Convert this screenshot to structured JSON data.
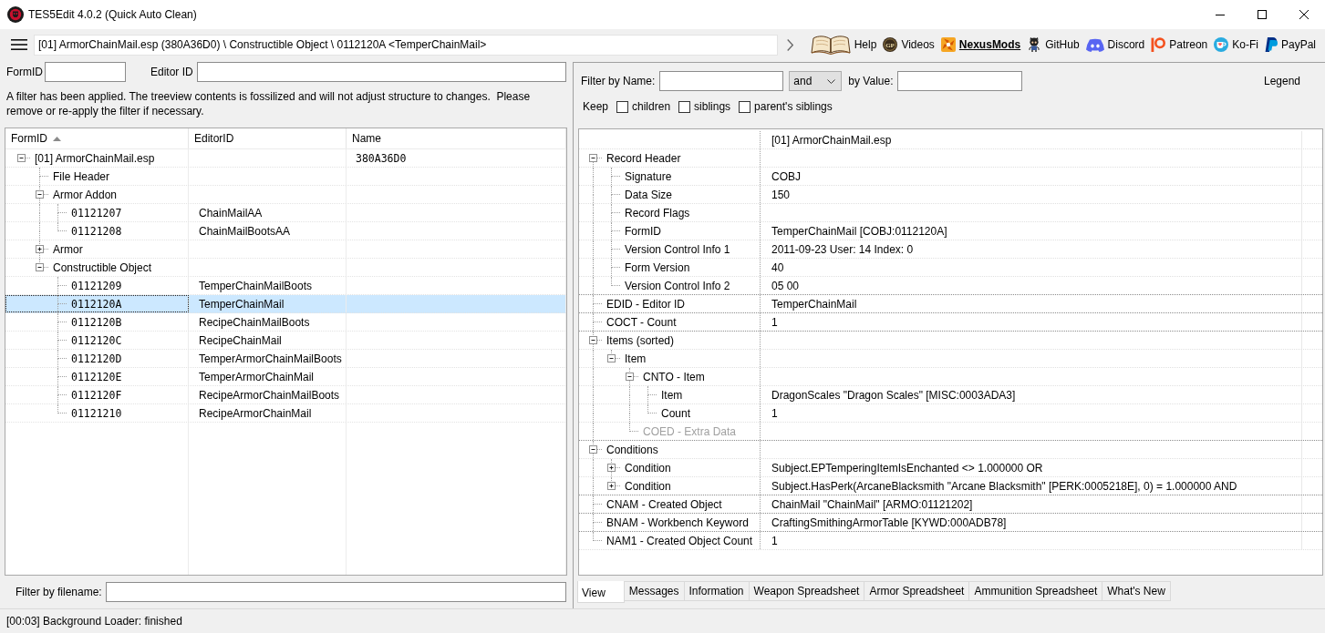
{
  "window": {
    "title": "TES5Edit 4.0.2 (Quick Auto Clean)"
  },
  "toolbar": {
    "path": "[01] ArmorChainMail.esp (380A36D0) \\ Constructible Object \\ 0112120A <TemperChainMail>",
    "links": [
      {
        "label": "Help",
        "kind": "book",
        "highlighted": false
      },
      {
        "label": "Videos",
        "kind": "coin",
        "badge": "GP",
        "highlighted": false
      },
      {
        "label": "NexusMods",
        "kind": "pinwheel",
        "highlighted": true
      },
      {
        "label": "GitHub",
        "kind": "mascot",
        "highlighted": false
      },
      {
        "label": "Discord",
        "kind": "controller",
        "highlighted": false
      },
      {
        "label": "Patreon",
        "kind": "pmark",
        "highlighted": false
      },
      {
        "label": "Ko-Fi",
        "kind": "cup",
        "highlighted": false
      },
      {
        "label": "PayPal",
        "kind": "plogo",
        "highlighted": false
      }
    ]
  },
  "left_panel": {
    "form_id_filter": {
      "label": "FormID"
    },
    "editor_id_filter": {
      "label": "Editor ID"
    },
    "notice": "A filter has been applied. The treeview contents is fossilized and will not adjust structure to changes.  Please remove or re-apply the filter if necessary.",
    "tree": {
      "columns": [
        {
          "label": "FormID",
          "sorted": true
        },
        {
          "label": "EditorID",
          "sorted": false
        },
        {
          "label": "Name",
          "sorted": false
        }
      ],
      "nodes": [
        {
          "kind": "group",
          "label": "[01] ArmorChainMail.esp",
          "name": "380A36D0",
          "expanded": true,
          "selected": false,
          "children": [
            {
              "kind": "group",
              "label": "File Header",
              "selected": false
            },
            {
              "kind": "group",
              "label": "Armor Addon",
              "expanded": true,
              "selected": false,
              "children": [
                {
                  "kind": "record",
                  "label": "01121207",
                  "editor_id": "ChainMailAA",
                  "selected": false
                },
                {
                  "kind": "record",
                  "label": "01121208",
                  "editor_id": "ChainMailBootsAA",
                  "selected": false
                }
              ]
            },
            {
              "kind": "group",
              "label": "Armor",
              "expanded": false,
              "selected": false
            },
            {
              "kind": "group",
              "label": "Constructible Object",
              "expanded": true,
              "selected": false,
              "children": [
                {
                  "kind": "record",
                  "label": "01121209",
                  "editor_id": "TemperChainMailBoots",
                  "selected": false
                },
                {
                  "kind": "record",
                  "label": "0112120A",
                  "editor_id": "TemperChainMail",
                  "selected": true
                },
                {
                  "kind": "record",
                  "label": "0112120B",
                  "editor_id": "RecipeChainMailBoots",
                  "selected": false
                },
                {
                  "kind": "record",
                  "label": "0112120C",
                  "editor_id": "RecipeChainMail",
                  "selected": false
                },
                {
                  "kind": "record",
                  "label": "0112120D",
                  "editor_id": "TemperArmorChainMailBoots",
                  "selected": false
                },
                {
                  "kind": "record",
                  "label": "0112120E",
                  "editor_id": "TemperArmorChainMail",
                  "selected": false
                },
                {
                  "kind": "record",
                  "label": "0112120F",
                  "editor_id": "RecipeArmorChainMailBoots",
                  "selected": false
                },
                {
                  "kind": "record",
                  "label": "01121210",
                  "editor_id": "RecipeArmorChainMail",
                  "selected": false
                }
              ]
            }
          ]
        }
      ]
    },
    "filename_filter": {
      "label": "Filter by filename:"
    }
  },
  "right_panel": {
    "name_filter": {
      "label": "Filter by Name:"
    },
    "operator": "and",
    "value_filter": {
      "label": "by Value:"
    },
    "legend": "Legend",
    "keep": {
      "label": "Keep",
      "options": [
        {
          "label": "children",
          "checked": false
        },
        {
          "label": "siblings",
          "checked": false
        },
        {
          "label": "parent's siblings",
          "checked": false
        }
      ]
    },
    "file_name": "[01] ArmorChainMail.esp",
    "fields": [
      {
        "label": "Record Header",
        "expanded": true,
        "disabled": false,
        "children": [
          {
            "label": "Signature",
            "value": "COBJ",
            "disabled": false
          },
          {
            "label": "Data Size",
            "value": "150",
            "disabled": false
          },
          {
            "label": "Record Flags",
            "disabled": false
          },
          {
            "label": "FormID",
            "value": "TemperChainMail [COBJ:0112120A]",
            "disabled": false
          },
          {
            "label": "Version Control Info 1",
            "value": "2011-09-23 User: 14 Index: 0",
            "disabled": false
          },
          {
            "label": "Form Version",
            "value": "40",
            "disabled": false
          },
          {
            "label": "Version Control Info 2",
            "value": "05 00",
            "disabled": false
          }
        ]
      },
      {
        "label": "EDID - Editor ID",
        "value": "TemperChainMail",
        "disabled": false
      },
      {
        "label": "COCT - Count",
        "value": "1",
        "disabled": false
      },
      {
        "label": "Items (sorted)",
        "expanded": true,
        "disabled": false,
        "children": [
          {
            "label": "Item",
            "expanded": true,
            "disabled": false,
            "children": [
              {
                "label": "CNTO - Item",
                "expanded": true,
                "disabled": false,
                "children": [
                  {
                    "label": "Item",
                    "value": "DragonScales \"Dragon Scales\" [MISC:0003ADA3]",
                    "disabled": false
                  },
                  {
                    "label": "Count",
                    "value": "1",
                    "disabled": false
                  }
                ]
              },
              {
                "label": "COED - Extra Data",
                "disabled": true
              }
            ]
          }
        ]
      },
      {
        "label": "Conditions",
        "expanded": true,
        "disabled": false,
        "children": [
          {
            "label": "Condition",
            "expanded": false,
            "value": "Subject.EPTemperingItemIsEnchanted <> 1.000000 OR",
            "disabled": false
          },
          {
            "label": "Condition",
            "expanded": false,
            "value": "Subject.HasPerk(ArcaneBlacksmith \"Arcane Blacksmith\" [PERK:0005218E], 0) = 1.000000 AND",
            "disabled": false
          }
        ]
      },
      {
        "label": "CNAM - Created Object",
        "value": "ChainMail \"ChainMail\" [ARMO:01121202]",
        "disabled": false
      },
      {
        "label": "BNAM - Workbench Keyword",
        "value": "CraftingSmithingArmorTable [KYWD:000ADB78]",
        "disabled": false
      },
      {
        "label": "NAM1 - Created Object Count",
        "value": "1",
        "disabled": false
      }
    ],
    "tabs": [
      {
        "label": "View",
        "selected": true
      },
      {
        "label": "Messages",
        "selected": false
      },
      {
        "label": "Information",
        "selected": false
      },
      {
        "label": "Weapon Spreadsheet",
        "selected": false
      },
      {
        "label": "Armor Spreadsheet",
        "selected": false
      },
      {
        "label": "Ammunition Spreadsheet",
        "selected": false
      },
      {
        "label": "What's New",
        "selected": false
      }
    ]
  },
  "status_bar": "[00:03] Background Loader: finished"
}
